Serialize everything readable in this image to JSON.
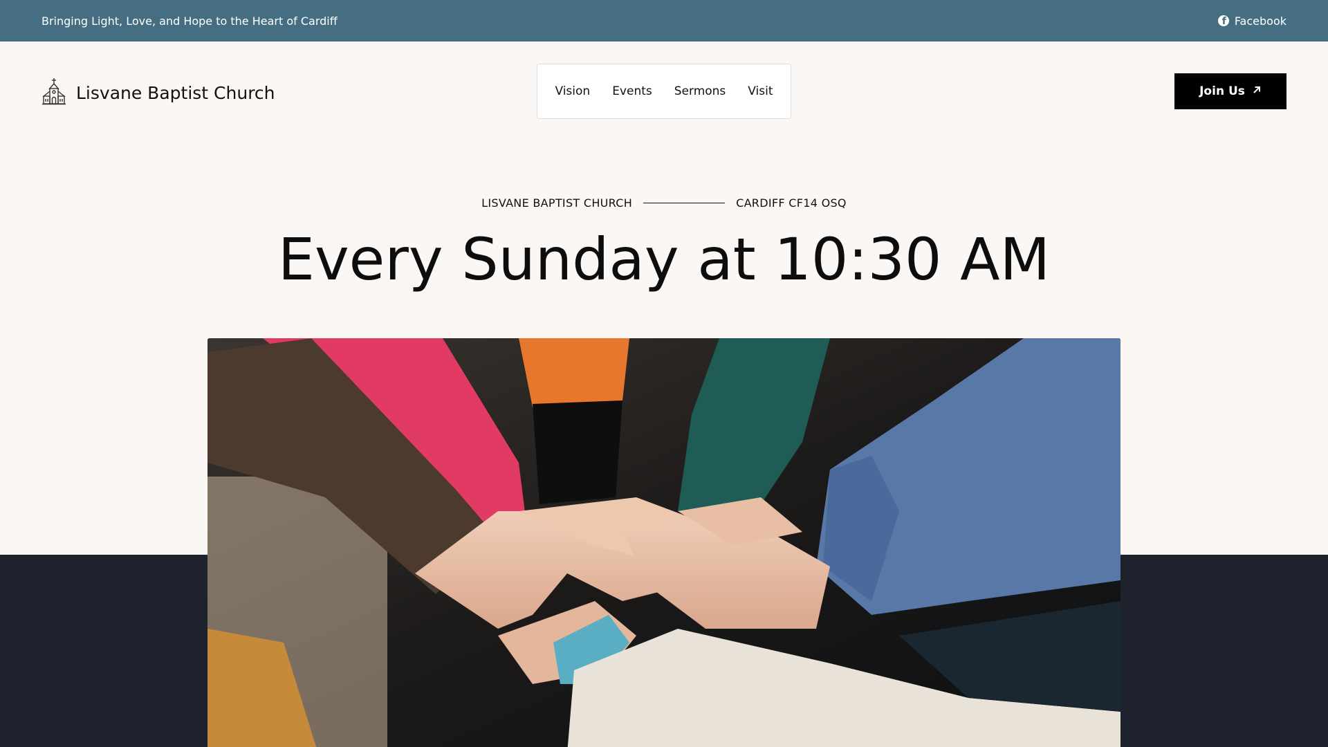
{
  "topbar": {
    "tagline": "Bringing Light, Love, and Hope to the Heart of Cardiff",
    "facebook_label": "Facebook",
    "background": "#456e82"
  },
  "brand": {
    "name": "Lisvane Baptist Church",
    "icon": "church-icon"
  },
  "nav": {
    "items": [
      {
        "label": "Vision"
      },
      {
        "label": "Events"
      },
      {
        "label": "Sermons"
      },
      {
        "label": "Visit"
      }
    ]
  },
  "cta": {
    "label": "Join Us",
    "icon": "arrow-up-right-icon"
  },
  "hero": {
    "eyebrow_left": "LISVANE BAPTIST CHURCH",
    "eyebrow_right": "CARDIFF CF14 OSQ",
    "headline": "Every Sunday at 10:30 AM",
    "image_subject": "hands-stacked-photo"
  },
  "colors": {
    "page_background": "#faf7f4",
    "dark_band": "#1e222c",
    "button": "#000000"
  }
}
